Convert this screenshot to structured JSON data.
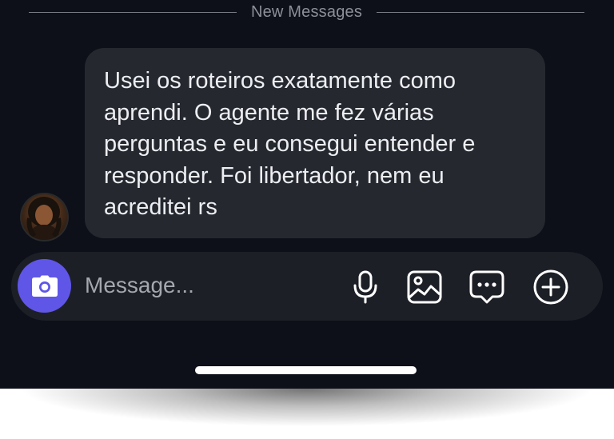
{
  "divider": {
    "label": "New Messages"
  },
  "message": {
    "text": "Usei os roteiros exatamente como\naprendi. O agente me fez várias\nperguntas e eu consegui entender e\nresponder. Foi libertador, nem eu\nacreditei rs"
  },
  "composer": {
    "placeholder": "Message...",
    "icons": [
      "camera-icon",
      "microphone-icon",
      "image-icon",
      "chat-bubble-icon",
      "plus-circle-icon"
    ]
  },
  "colors": {
    "background": "#0d0f19",
    "bubble": "#262830",
    "composer": "#1d1f27",
    "camera_accent": "#5f56e8"
  }
}
